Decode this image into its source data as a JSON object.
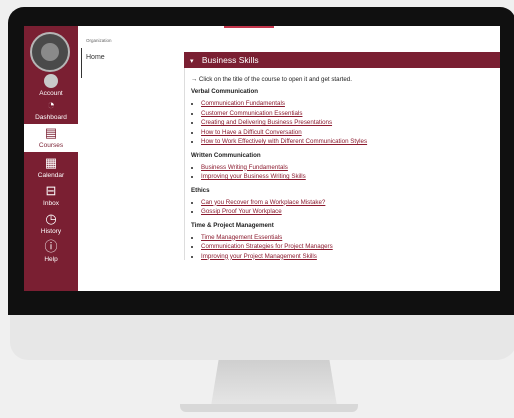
{
  "nav": {
    "account": "Account",
    "dashboard": "Dashboard",
    "courses": "Courses",
    "calendar": "Calendar",
    "inbox": "Inbox",
    "history": "History",
    "help": "Help"
  },
  "course_nav": {
    "org_label": "Organization",
    "home": "Home"
  },
  "module": {
    "title": "Business Skills",
    "intro": "→ Click on the title of the course to open it and get started.",
    "sections": [
      {
        "heading": "Verbal Communication",
        "links": [
          "Communication Fundamentals",
          "Customer Communication Essentials",
          "Creating and Delivering Business Presentations",
          "How to Have a Difficult Conversation",
          "How to Work Effectively with Different Communication Styles"
        ]
      },
      {
        "heading": "Written Communication",
        "links": [
          "Business Writing Fundamentals",
          "Improving your Business Writing Skills"
        ]
      },
      {
        "heading": "Ethics",
        "links": [
          "Can you Recover from a Workplace Mistake?",
          "Gossip Proof Your Workplace"
        ]
      },
      {
        "heading": "Time & Project Management",
        "links": [
          "Time Management Essentials",
          "Communication Strategies for Project Managers",
          "Improving your Project Management Skills"
        ]
      }
    ]
  },
  "colors": {
    "brand": "#7a1f32",
    "link": "#8b1a2e"
  }
}
